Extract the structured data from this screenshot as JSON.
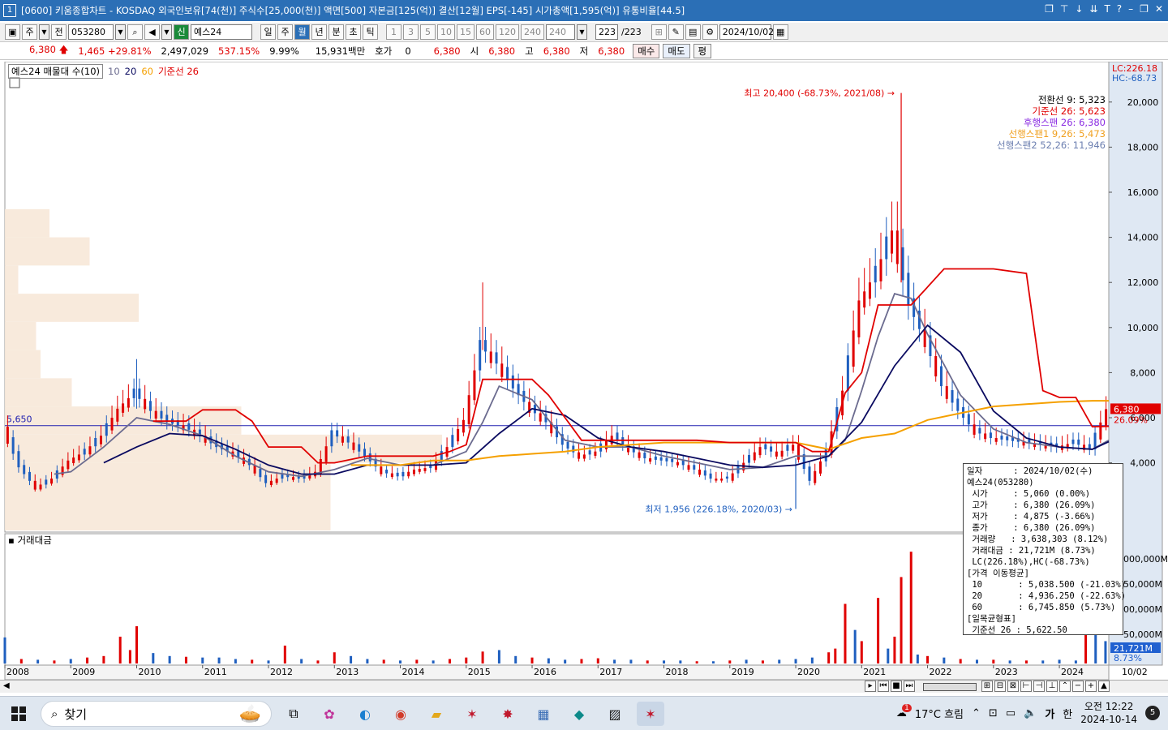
{
  "window": {
    "number": "1",
    "title": "[0600] 키움종합차트 - KOSDAQ 외국인보유[74(천)] 주식수[25,000(천)] 액면[500] 자본금[125(억)] 결산[12월] EPS[-145] 시가총액[1,595(억)] 유통비율[44.5]"
  },
  "toolbar": {
    "period_select": "주",
    "prev_label": "전",
    "code": "053280",
    "shin": "신",
    "stock_name": "예스24",
    "timeframes": [
      "일",
      "주",
      "월",
      "년",
      "분",
      "초",
      "틱"
    ],
    "active_timeframe": "월",
    "intervals": [
      "1",
      "3",
      "5",
      "10",
      "15",
      "60",
      "120",
      "240",
      "240"
    ],
    "count": "223",
    "count_total": "/223",
    "date": "2024/10/02"
  },
  "quote": {
    "price": "6,380",
    "change": "1,465",
    "change_pct": "+29.81%",
    "volume": "2,497,029",
    "vol_ratio": "537.15%",
    "turnover": "9.99%",
    "amount": "15,931백만",
    "hoga_label": "호가",
    "hoga_value": "0",
    "hoga_price": "6,380",
    "open_label": "시",
    "open": "6,380",
    "high_label": "고",
    "high": "6,380",
    "low_label": "저",
    "low": "6,380",
    "buy_label": "매수",
    "sell_label": "매도",
    "flat_label": "평"
  },
  "legend": {
    "main": "예스24 매물대 수(10)",
    "ma10": "10",
    "ma20": "20",
    "ma60": "60",
    "base": "기준선 26",
    "volume_title": "거래대금",
    "lc": "LC:226.18",
    "hc": "HC:-68.73",
    "high_note": "최고 20,400 (-68.73%, 2021/08)",
    "low_note": "최저 1,956 (226.18%, 2020/03)",
    "ref_price": "5,650",
    "cur_price": "6,380",
    "cur_pct": "26.09%",
    "vol_cur": "21,721M",
    "vol_pct": "8.73%",
    "end_date": "10/02"
  },
  "ichimoku": [
    {
      "text": "전환선 9: 5,323",
      "color": "#000000"
    },
    {
      "text": "기준선 26: 5,623",
      "color": "#e00000"
    },
    {
      "text": "후행스팬 26: 6,380",
      "color": "#8a2be2"
    },
    {
      "text": "선행스팬1 9,26: 5,473",
      "color": "#f0a020"
    },
    {
      "text": "선행스팬2 52,26: 11,946",
      "color": "#6c7fb0"
    }
  ],
  "info": [
    "일자      : 2024/10/02(수)",
    "예스24(053280)",
    " 시가     : 5,060 (0.00%)",
    " 고가     : 6,380 (26.09%)",
    " 저가     : 4,875 (-3.66%)",
    " 종가     : 6,380 (26.09%)",
    " 거래량   : 3,638,303 (8.12%)",
    " 거래대금 : 21,721M (8.73%)",
    " LC(226.18%),HC(-68.73%)",
    "[가격 이동평균]",
    " 10       : 5,038.500 (-21.03%)",
    " 20       : 4,936.250 (-22.63%)",
    " 60       : 6,745.850 (5.73%)",
    "[일목균형표]",
    " 기준선 26 : 5,622.50"
  ],
  "taskbar": {
    "search_placeholder": "찾기",
    "weather": "17°C  흐림",
    "weather_badge": "1",
    "lang": "가",
    "ime": "한",
    "time": "오전 12:22",
    "date": "2024-10-14",
    "notif": "5"
  },
  "chart_data": {
    "type": "line",
    "title": "",
    "ylim": [
      1000,
      21000
    ],
    "yticks": [
      4000,
      6000,
      8000,
      10000,
      12000,
      14000,
      16000,
      18000,
      20000
    ],
    "ytick_labels": [
      "4,000",
      "6,000",
      "8,000",
      "10,000",
      "12,000",
      "14,000",
      "16,000",
      "18,000",
      "20,000"
    ],
    "vol_tick_labels": [
      "000,000M",
      "50,000M",
      "00,000M",
      "50,000M"
    ],
    "x_labels": [
      "2008",
      "2009",
      "2010",
      "2011",
      "2012",
      "2013",
      "2014",
      "2015",
      "2016",
      "2017",
      "2018",
      "2019",
      "2020",
      "2021",
      "2022",
      "2023",
      "2024"
    ],
    "x_start": 2008.0,
    "x_end": 2024.75,
    "volume_profile": [
      {
        "low": 1000,
        "high": 4000,
        "strength": 0.73
      },
      {
        "low": 4000,
        "high": 5250,
        "strength": 0.98
      },
      {
        "low": 5250,
        "high": 6500,
        "strength": 0.53
      },
      {
        "low": 6500,
        "high": 7750,
        "strength": 0.15
      },
      {
        "low": 7750,
        "high": 9000,
        "strength": 0.08
      },
      {
        "low": 9000,
        "high": 10250,
        "strength": 0.07
      },
      {
        "low": 10250,
        "high": 11500,
        "strength": 0.3
      },
      {
        "low": 11500,
        "high": 12750,
        "strength": 0.03
      },
      {
        "low": 12750,
        "high": 14000,
        "strength": 0.19
      },
      {
        "low": 14000,
        "high": 15250,
        "strength": 0.1
      }
    ],
    "series": [
      {
        "name": "종가",
        "color": "#1f5fbf",
        "x": [
          2008.0,
          2008.25,
          2008.5,
          2008.75,
          2009.0,
          2009.25,
          2009.5,
          2009.75,
          2010.0,
          2010.25,
          2010.5,
          2010.75,
          2011.0,
          2011.25,
          2011.5,
          2011.75,
          2012.0,
          2012.25,
          2012.5,
          2012.75,
          2013.0,
          2013.25,
          2013.5,
          2013.75,
          2014.0,
          2014.25,
          2014.5,
          2014.75,
          2015.0,
          2015.25,
          2015.5,
          2015.75,
          2016.0,
          2016.25,
          2016.5,
          2016.75,
          2017.0,
          2017.25,
          2017.5,
          2017.75,
          2018.0,
          2018.25,
          2018.5,
          2018.75,
          2019.0,
          2019.25,
          2019.5,
          2019.75,
          2020.0,
          2020.25,
          2020.5,
          2020.75,
          2021.0,
          2021.25,
          2021.5,
          2021.75,
          2022.0,
          2022.25,
          2022.5,
          2022.75,
          2023.0,
          2023.25,
          2023.5,
          2023.75,
          2024.0,
          2024.25,
          2024.5,
          2024.75
        ],
        "values": [
          5600,
          3800,
          2900,
          3300,
          4100,
          4500,
          5200,
          6400,
          7100,
          6300,
          5800,
          5600,
          5200,
          4700,
          4400,
          3900,
          3100,
          3400,
          3300,
          3600,
          5300,
          4900,
          4300,
          3600,
          3400,
          3700,
          3800,
          4700,
          5900,
          9200,
          8400,
          7300,
          6400,
          5800,
          4800,
          4300,
          4500,
          5200,
          4600,
          4200,
          4100,
          4000,
          3700,
          3300,
          3300,
          4000,
          4700,
          4400,
          4800,
          3200,
          4500,
          7200,
          11200,
          12400,
          14300,
          11000,
          9400,
          7400,
          6300,
          5400,
          5100,
          5000,
          4900,
          4800,
          4700,
          4900,
          4600,
          6380
        ]
      },
      {
        "name": "10",
        "color": "#6b6b8f",
        "x": [
          2008.75,
          2009.0,
          2009.5,
          2010.0,
          2010.5,
          2011.0,
          2011.5,
          2012.0,
          2012.5,
          2013.0,
          2013.5,
          2014.0,
          2014.5,
          2015.0,
          2015.25,
          2015.5,
          2016.0,
          2016.5,
          2017.0,
          2017.5,
          2018.0,
          2018.5,
          2019.0,
          2019.5,
          2020.0,
          2020.5,
          2020.75,
          2021.0,
          2021.25,
          2021.5,
          2021.75,
          2022.0,
          2022.5,
          2023.0,
          2023.5,
          2024.0,
          2024.5,
          2024.75
        ],
        "values": [
          3500,
          3600,
          4700,
          6000,
          5700,
          5200,
          4300,
          3600,
          3400,
          3700,
          4200,
          3900,
          3900,
          4500,
          5800,
          7400,
          6800,
          5000,
          4700,
          4700,
          4300,
          4000,
          3700,
          3800,
          4300,
          4300,
          5000,
          7200,
          9600,
          11500,
          11300,
          9700,
          7000,
          5500,
          4900,
          4700,
          4600,
          5000
        ]
      },
      {
        "name": "20",
        "color": "#0a0a60",
        "x": [
          2009.5,
          2010.0,
          2010.5,
          2011.0,
          2011.5,
          2012.0,
          2012.5,
          2013.0,
          2013.5,
          2014.0,
          2014.5,
          2015.0,
          2015.5,
          2016.0,
          2016.5,
          2017.0,
          2017.5,
          2018.0,
          2018.5,
          2019.0,
          2019.5,
          2020.0,
          2020.5,
          2021.0,
          2021.5,
          2022.0,
          2022.5,
          2023.0,
          2023.5,
          2024.0,
          2024.5,
          2024.75
        ],
        "values": [
          4000,
          4700,
          5300,
          5200,
          4600,
          3900,
          3500,
          3500,
          3900,
          3900,
          3900,
          4000,
          5300,
          6400,
          6100,
          5100,
          4700,
          4500,
          4200,
          3900,
          3800,
          3900,
          4300,
          5800,
          8300,
          10100,
          8900,
          6300,
          5100,
          4700,
          4600,
          4940
        ]
      },
      {
        "name": "60",
        "color": "#f5a000",
        "x": [
          2013.25,
          2013.5,
          2014.0,
          2014.5,
          2015.0,
          2015.5,
          2016.0,
          2016.5,
          2017.0,
          2017.5,
          2018.0,
          2018.5,
          2019.0,
          2019.5,
          2020.0,
          2020.5,
          2021.0,
          2021.5,
          2022.0,
          2022.5,
          2023.0,
          2023.5,
          2024.0,
          2024.5,
          2024.75
        ],
        "values": [
          3900,
          3900,
          3900,
          4100,
          4100,
          4300,
          4400,
          4500,
          4700,
          4800,
          4900,
          4900,
          4900,
          4900,
          4900,
          4600,
          5100,
          5300,
          5900,
          6200,
          6500,
          6600,
          6700,
          6750,
          6750
        ]
      },
      {
        "name": "기준선 26",
        "color": "#e00000",
        "x": [
          2010.25,
          2010.75,
          2011.0,
          2011.5,
          2011.75,
          2012.0,
          2012.5,
          2012.75,
          2013.0,
          2013.5,
          2014.0,
          2014.5,
          2014.75,
          2015.0,
          2015.25,
          2016.0,
          2016.25,
          2016.75,
          2017.0,
          2017.5,
          2018.0,
          2018.5,
          2019.0,
          2019.5,
          2020.0,
          2020.25,
          2020.5,
          2020.75,
          2021.0,
          2021.25,
          2021.5,
          2021.75,
          2022.0,
          2022.25,
          2022.5,
          2023.0,
          2023.5,
          2023.75,
          2024.0,
          2024.25,
          2024.5,
          2024.75
        ],
        "values": [
          5850,
          5850,
          6350,
          6350,
          5850,
          4700,
          4700,
          4000,
          4000,
          4300,
          4300,
          4300,
          4500,
          4800,
          7700,
          7700,
          7000,
          5000,
          5000,
          5000,
          5000,
          5000,
          4900,
          4900,
          4900,
          4500,
          4500,
          7100,
          8000,
          11000,
          11000,
          11000,
          11800,
          12600,
          12600,
          12600,
          12400,
          7200,
          6900,
          6900,
          5600,
          5620
        ]
      }
    ],
    "extremes": {
      "high": 20400,
      "low": 1956
    },
    "volume": {
      "ymax": 160000,
      "bars": [
        [
          2008.0,
          35000,
          "b"
        ],
        [
          2008.25,
          6000,
          "r"
        ],
        [
          2008.5,
          5000,
          "b"
        ],
        [
          2008.75,
          4000,
          "r"
        ],
        [
          2009.0,
          6000,
          "b"
        ],
        [
          2009.25,
          8000,
          "r"
        ],
        [
          2009.5,
          10000,
          "r"
        ],
        [
          2009.75,
          36000,
          "r"
        ],
        [
          2009.9,
          18000,
          "r"
        ],
        [
          2010.0,
          50000,
          "r"
        ],
        [
          2010.25,
          14000,
          "b"
        ],
        [
          2010.5,
          10000,
          "b"
        ],
        [
          2010.75,
          9000,
          "r"
        ],
        [
          2011.0,
          8000,
          "b"
        ],
        [
          2011.25,
          8000,
          "b"
        ],
        [
          2011.5,
          6000,
          "b"
        ],
        [
          2011.75,
          5000,
          "r"
        ],
        [
          2012.0,
          4000,
          "b"
        ],
        [
          2012.25,
          24000,
          "r"
        ],
        [
          2012.5,
          6000,
          "b"
        ],
        [
          2012.75,
          4000,
          "r"
        ],
        [
          2013.0,
          15000,
          "r"
        ],
        [
          2013.25,
          10000,
          "b"
        ],
        [
          2013.5,
          6000,
          "b"
        ],
        [
          2013.75,
          5000,
          "r"
        ],
        [
          2014.0,
          4000,
          "b"
        ],
        [
          2014.25,
          5000,
          "r"
        ],
        [
          2014.5,
          4000,
          "b"
        ],
        [
          2014.75,
          6000,
          "r"
        ],
        [
          2015.0,
          8000,
          "r"
        ],
        [
          2015.25,
          16000,
          "r"
        ],
        [
          2015.5,
          18000,
          "b"
        ],
        [
          2015.75,
          10000,
          "b"
        ],
        [
          2016.0,
          8000,
          "r"
        ],
        [
          2016.25,
          7000,
          "b"
        ],
        [
          2016.5,
          5000,
          "b"
        ],
        [
          2016.75,
          6000,
          "r"
        ],
        [
          2017.0,
          7000,
          "r"
        ],
        [
          2017.25,
          5000,
          "b"
        ],
        [
          2017.5,
          5000,
          "b"
        ],
        [
          2017.75,
          4000,
          "r"
        ],
        [
          2018.0,
          4000,
          "b"
        ],
        [
          2018.25,
          4000,
          "b"
        ],
        [
          2018.5,
          3000,
          "r"
        ],
        [
          2018.75,
          3000,
          "b"
        ],
        [
          2019.0,
          4000,
          "r"
        ],
        [
          2019.25,
          5000,
          "b"
        ],
        [
          2019.5,
          4000,
          "r"
        ],
        [
          2019.75,
          5000,
          "b"
        ],
        [
          2020.0,
          6000,
          "b"
        ],
        [
          2020.25,
          8000,
          "b"
        ],
        [
          2020.5,
          15000,
          "r"
        ],
        [
          2020.6,
          20000,
          "r"
        ],
        [
          2020.75,
          80000,
          "r"
        ],
        [
          2020.9,
          45000,
          "b"
        ],
        [
          2021.0,
          30000,
          "r"
        ],
        [
          2021.25,
          88000,
          "r"
        ],
        [
          2021.4,
          20000,
          "b"
        ],
        [
          2021.5,
          36000,
          "r"
        ],
        [
          2021.6,
          116000,
          "r"
        ],
        [
          2021.75,
          150000,
          "r"
        ],
        [
          2021.85,
          12000,
          "b"
        ],
        [
          2022.0,
          10000,
          "r"
        ],
        [
          2022.25,
          8000,
          "b"
        ],
        [
          2022.5,
          6000,
          "r"
        ],
        [
          2022.75,
          5000,
          "b"
        ],
        [
          2023.0,
          5000,
          "r"
        ],
        [
          2023.25,
          4000,
          "b"
        ],
        [
          2023.5,
          4000,
          "r"
        ],
        [
          2023.75,
          4000,
          "b"
        ],
        [
          2024.0,
          5000,
          "b"
        ],
        [
          2024.25,
          4000,
          "b"
        ],
        [
          2024.4,
          52000,
          "r"
        ],
        [
          2024.55,
          46000,
          "b"
        ],
        [
          2024.7,
          30000,
          "b"
        ]
      ]
    }
  }
}
